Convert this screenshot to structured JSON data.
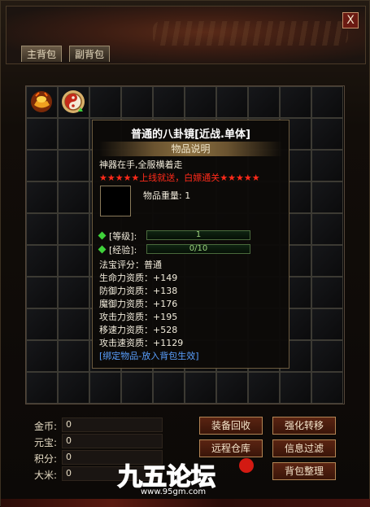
{
  "window": {
    "close_label": "X"
  },
  "tabs": [
    {
      "label": "主背包"
    },
    {
      "label": "副背包"
    }
  ],
  "tooltip": {
    "title": "普通的八卦镜[近战.单体]",
    "section": "物品说明",
    "desc": "神器在手,全服横着走",
    "stars_left": "★★★★★",
    "promo": "上线就送，白嫖通关",
    "stars_right": "★★★★★",
    "weight_label": "物品重量:",
    "weight_value": "1",
    "level_label": "[等级]:",
    "level_value": "1",
    "exp_label": "[经验]:",
    "exp_value": "0/10",
    "exp_fraction": 0,
    "score": "法宝评分：普通",
    "stats": [
      "生命力资质：+149",
      "防御力资质：+138",
      "魔御力资质：+176",
      "攻击力资质：+195",
      "移速力资质：+528",
      "攻击速资质：+1129"
    ],
    "bind_note": "[绑定物品-放入背包生效]"
  },
  "currency": [
    {
      "label": "金币:",
      "value": "0"
    },
    {
      "label": "元宝:",
      "value": "0"
    },
    {
      "label": "积分:",
      "value": "0"
    },
    {
      "label": "大米:",
      "value": "0"
    }
  ],
  "buttons": {
    "recycle": "装备回收",
    "transfer": "强化转移",
    "remote_storage": "远程仓库",
    "filter": "信息过滤",
    "sort": "背包整理"
  },
  "watermark": {
    "brand": "九五论坛",
    "url": "www.95gm.com"
  },
  "colors": {
    "accent_red": "#ff2a1a",
    "bind_blue": "#5aa0ff",
    "button_bg": "#5a2412"
  }
}
